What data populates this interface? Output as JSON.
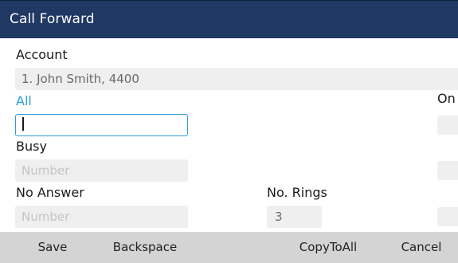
{
  "window": {
    "title": "Call Forward"
  },
  "account": {
    "label": "Account",
    "value": "1. John Smith, 4400"
  },
  "all": {
    "label": "All",
    "value": "",
    "on_label": "On"
  },
  "busy": {
    "label": "Busy",
    "placeholder": "Number"
  },
  "no_answer": {
    "label": "No Answer",
    "placeholder": "Number",
    "rings_label": "No. Rings",
    "rings_value": "3"
  },
  "softkeys": {
    "save": "Save",
    "backspace": "Backspace",
    "copy_to_all": "CopyToAll",
    "cancel": "Cancel"
  },
  "colors": {
    "title_bar": "#1f3864",
    "accent": "#2b9fd9",
    "field_bg": "#efefef",
    "softkey_bar": "#d4d4d4"
  }
}
